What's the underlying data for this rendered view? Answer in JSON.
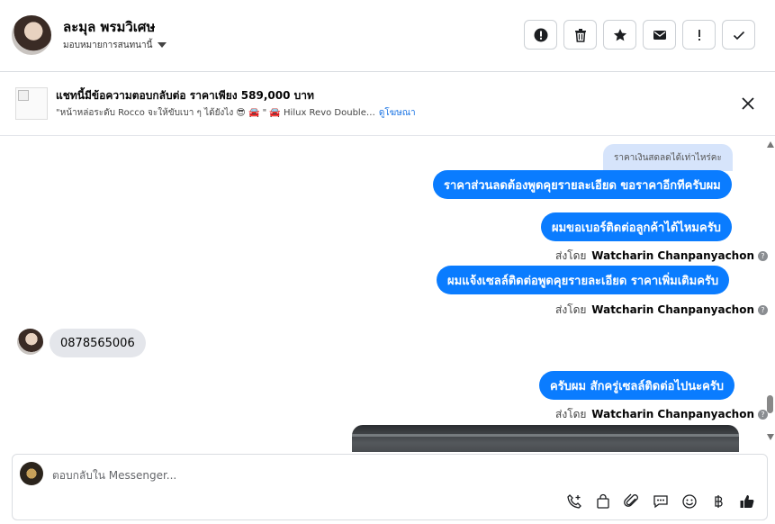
{
  "header": {
    "contact_name": "ละมุล พรมวิเศษ",
    "assign_label": "มอบหมายการสนทนานี้"
  },
  "toolbar": {
    "buttons": [
      {
        "name": "report-button",
        "icon": "alert-circle-icon"
      },
      {
        "name": "delete-button",
        "icon": "trash-icon"
      },
      {
        "name": "star-button",
        "icon": "star-icon"
      },
      {
        "name": "mark-unread-button",
        "icon": "envelope-icon"
      },
      {
        "name": "follow-up-button",
        "icon": "exclamation-icon"
      },
      {
        "name": "mark-done-button",
        "icon": "checkmark-icon"
      }
    ]
  },
  "banner": {
    "title": "แชทนี้มีข้อความตอบกลับต่อ ราคาเพียง 589,000 บาท",
    "subtitle": "\"หน้าหล่อระดับ Rocco จะให้ขับเบา ๆ ได้ยังไง 😎 🚘 \" 🚘 Hilux Revo Double…",
    "link": "ดูโฆษณา"
  },
  "messages": {
    "quoted": "ราคาเงินสดลดได้เท่าไหร่คะ",
    "m1": "ราคาส่วนลดต้องพูดคุยรายละเอียด ขอราคาอีกทีครับผม",
    "m2": "ผมขอเบอร์ติดต่อลูกค้าได้ไหมครับ",
    "sent_by_prefix": "ส่งโดย",
    "sender": "Watcharin Chanpanyachon",
    "m3": "ผมแจ้งเซลล์ติดต่อพูดคุยรายละเอียด ราคาเพิ่มเติมครับ",
    "incoming": "0878565006",
    "m4": "ครับผม สักครู่เซลล์ติดต่อไปนะครับ"
  },
  "composer": {
    "placeholder": "ตอบกลับใน Messenger..."
  },
  "colors": {
    "outgoing": "#0a7cff",
    "incoming": "#e4e6eb",
    "link": "#1b74e4"
  }
}
